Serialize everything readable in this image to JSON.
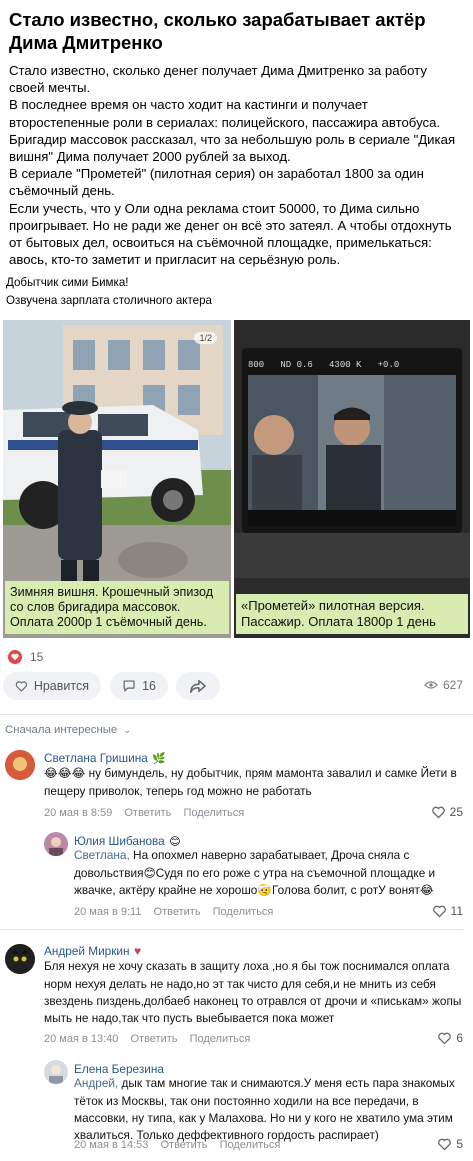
{
  "post": {
    "title": "Стало известно, сколько зарабатывает актёр Дима Дмитренко",
    "paragraphs": [
      "Стало известно, сколько денег получает Дима Дмитренко за работу своей мечты.",
      "В последнее время он часто ходит на кастинги и получает второстепенные роли в сериалах: полицейского, пассажира автобуса.",
      "Бригадир массовок рассказал, что за небольшую роль в сериале \"Дикая вишня\" Дима получает 2000 рублей за выход.",
      "В сериале \"Прометей\" (пилотная серия) он заработал 1800 за один съёмочный день.",
      "Если учесть, что у Оли одна реклама стоит 50000, то Дима сильно проигрывает. Но не ради же денег он всё это затеял. А чтобы отдохнуть от бытовых дел, освоиться на съёмочной площадке, примелькаться: авось, кто-то заметит и пригласит на серьёзную роль."
    ],
    "extra_lines": [
      "Добытчик сими Бимка!",
      "Озвучена зарплата столичного актера"
    ],
    "image_left_caption": "Зимняя вишня. Крошечный эпизод со слов бригадира массовок. Оплата 2000р 1 съёмочный день.",
    "image_left_badge": "1/2",
    "image_right_caption": "«Прометей» пилотная версия. Пассажир. Оплата 1800р 1 день",
    "image_right_monitor_text": "800   ND 0.6   4300 K   +0.0",
    "reaction_count": "15",
    "like_label": "Нравится",
    "comments_count": "16",
    "views": "627"
  },
  "comments_header": "Сначала интересные",
  "comments": [
    {
      "author": "Светлана Гришина",
      "author_emoji": "🌿",
      "text": "😂😂😂 ну бимундель, ну добытчик, прям мамонта завалил и самке Йети в пещеру приволок, теперь год можно не работать",
      "date": "20 мая в 8:59",
      "reply": "Ответить",
      "share": "Поделиться",
      "likes": "25"
    },
    {
      "author": "Юлия Шибанова",
      "author_emoji": "😊",
      "mention": "Светлана,",
      "text": " На опохмел наверно зарабатывает, Дроча сняла с довольствия😊Судя по его роже с утра на съемочной площадке и жвачке, актёру крайне не хорошо🤕Голова болит, с ротУ вонят😂",
      "date": "20 мая в 9:11",
      "reply": "Ответить",
      "share": "Поделиться",
      "likes": "11"
    },
    {
      "author": "Андрей Миркин",
      "author_emoji": "♥",
      "text": "Бля нехуя не хочу сказать в защиту лоха ,но я бы тож поснимался оплата норм нехуя делать не надо,но эт так чисто для себя,и не мнить из себя звездень пиздень,долбаеб наконец то отравлся от дрочи и «писькам» жопы мыть не надо,так что пусть выебывается пока может",
      "date": "20 мая в 13:40",
      "reply": "Ответить",
      "share": "Поделиться",
      "likes": "6"
    },
    {
      "author": "Елена Березина",
      "mention": "Андрей,",
      "text": " дык там многие так и снимаются.У меня есть пара знакомых тёток из Москвы, так они постоянно ходили на все передачи, в массовки, ну типа, как у Малахова. Но ни у кого не хватило ума этим хвалиться. Только деффективного гордость распирает)",
      "date": "20 мая в 14:53",
      "reply": "Ответить",
      "share": "Поделиться",
      "likes": "5"
    }
  ],
  "colors": {
    "link": "#2a5885",
    "caption_bg": "#d8ebb0",
    "heart": "#e64646",
    "button_bg": "#f0f2f5"
  }
}
